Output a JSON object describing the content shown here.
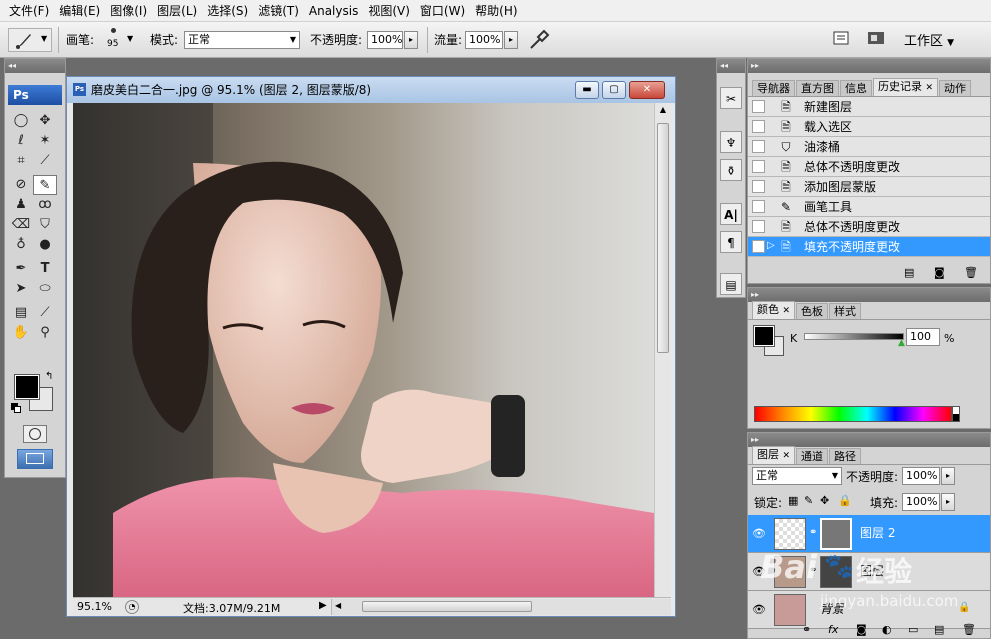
{
  "menu": [
    "文件(F)",
    "编辑(E)",
    "图像(I)",
    "图层(L)",
    "选择(S)",
    "滤镜(T)",
    "Analysis",
    "视图(V)",
    "窗口(W)",
    "帮助(H)"
  ],
  "options": {
    "brush_label": "画笔:",
    "brush_size": "95",
    "mode_label": "模式:",
    "mode_value": "正常",
    "opacity_label": "不透明度:",
    "opacity_value": "100%",
    "flow_label": "流量:",
    "flow_value": "100%",
    "workspace_label": "工作区"
  },
  "toolbox": {
    "badge": "Ps"
  },
  "document": {
    "title": "磨皮美白二合一.jpg @ 95.1% (图层 2, 图层蒙版/8)",
    "zoom": "95.1%",
    "doc_info": "文档:3.07M/9.21M"
  },
  "history_panel": {
    "tabs": [
      "导航器",
      "直方图",
      "信息",
      "历史记录",
      "动作"
    ],
    "active_tab": "历史记录",
    "items": [
      {
        "label": "新建图层",
        "icon": "document-icon"
      },
      {
        "label": "载入选区",
        "icon": "document-icon"
      },
      {
        "label": "油漆桶",
        "icon": "paint-bucket-icon"
      },
      {
        "label": "总体不透明度更改",
        "icon": "document-icon"
      },
      {
        "label": "添加图层蒙版",
        "icon": "document-icon"
      },
      {
        "label": "画笔工具",
        "icon": "brush-icon"
      },
      {
        "label": "总体不透明度更改",
        "icon": "document-icon"
      },
      {
        "label": "填充不透明度更改",
        "icon": "document-icon"
      }
    ],
    "selected_index": 7
  },
  "color_panel": {
    "tabs": [
      "颜色",
      "色板",
      "样式"
    ],
    "channel_label": "K",
    "value": "100",
    "unit": "%"
  },
  "layers_panel": {
    "tabs": [
      "图层",
      "通道",
      "路径"
    ],
    "blend_mode": "正常",
    "opacity_label": "不透明度:",
    "opacity_value": "100%",
    "lock_label": "锁定:",
    "fill_label": "填充:",
    "fill_value": "100%",
    "layers": [
      {
        "name": "图层 2",
        "selected": true
      },
      {
        "name": "图层",
        "selected": false
      },
      {
        "name": "背景",
        "selected": false
      }
    ]
  },
  "watermark": {
    "text1": "Bai",
    "text2": "经验",
    "url": "jingyan.baidu.com"
  },
  "colors": {
    "selection": "#3399ff",
    "ps_blue": "#1d4fa3",
    "shirt_pink": "#e07a94"
  }
}
